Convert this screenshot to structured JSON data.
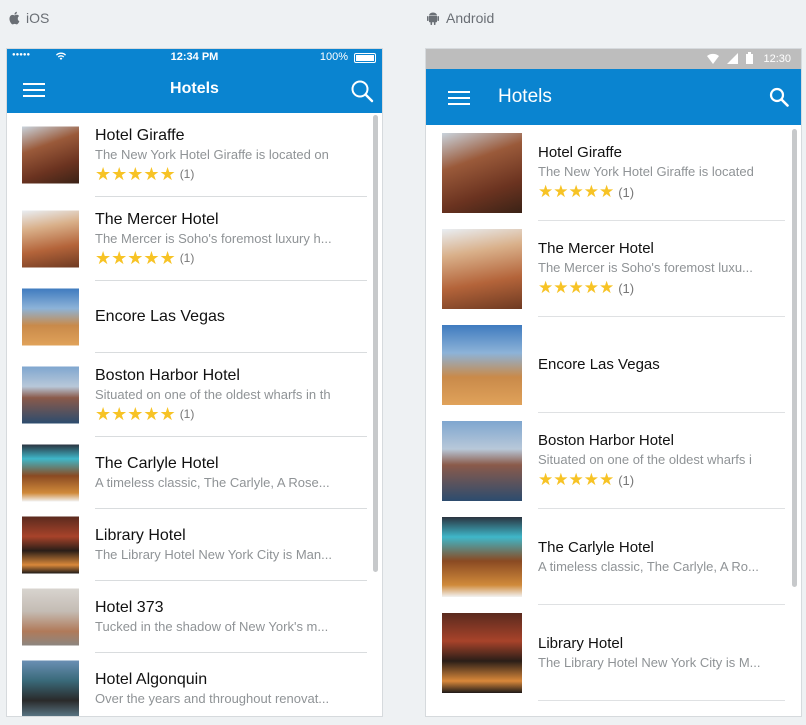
{
  "platforms": {
    "ios": "iOS",
    "android": "Android"
  },
  "ios": {
    "status": {
      "time": "12:34 PM",
      "battery": "100%"
    },
    "title": "Hotels"
  },
  "android": {
    "status": {
      "time": "12:30"
    },
    "title": "Hotels"
  },
  "rating_count": "(1)",
  "hotels_ios": [
    {
      "name": "Hotel Giraffe",
      "desc": "The New York Hotel Giraffe is located on",
      "rated": true
    },
    {
      "name": "The Mercer Hotel",
      "desc": "The Mercer is Soho's foremost luxury h...",
      "rated": true
    },
    {
      "name": "Encore Las Vegas",
      "desc": "",
      "rated": false
    },
    {
      "name": "Boston Harbor Hotel",
      "desc": "Situated on one of the oldest wharfs in th",
      "rated": true
    },
    {
      "name": "The Carlyle Hotel",
      "desc": "A timeless classic, The Carlyle, A Rose...",
      "rated": false
    },
    {
      "name": "Library Hotel",
      "desc": "The Library Hotel New York City is Man...",
      "rated": false
    },
    {
      "name": "Hotel 373",
      "desc": "Tucked in the shadow of New York's m...",
      "rated": false
    },
    {
      "name": "Hotel Algonquin",
      "desc": "Over the years and throughout renovat...",
      "rated": false
    }
  ],
  "hotels_android": [
    {
      "name": "Hotel Giraffe",
      "desc": "The New York Hotel Giraffe is located",
      "rated": true
    },
    {
      "name": "The Mercer Hotel",
      "desc": "The Mercer is Soho's foremost luxu...",
      "rated": true
    },
    {
      "name": "Encore Las Vegas",
      "desc": "",
      "rated": false
    },
    {
      "name": "Boston Harbor Hotel",
      "desc": "Situated on one of the oldest wharfs i",
      "rated": true
    },
    {
      "name": "The Carlyle Hotel",
      "desc": "A timeless classic, The Carlyle, A Ro...",
      "rated": false
    },
    {
      "name": "Library Hotel",
      "desc": "The Library Hotel New York City is M...",
      "rated": false
    }
  ],
  "stars": "★★★★★",
  "colors": {
    "accent": "#0a84d0",
    "star": "#f7c325"
  }
}
